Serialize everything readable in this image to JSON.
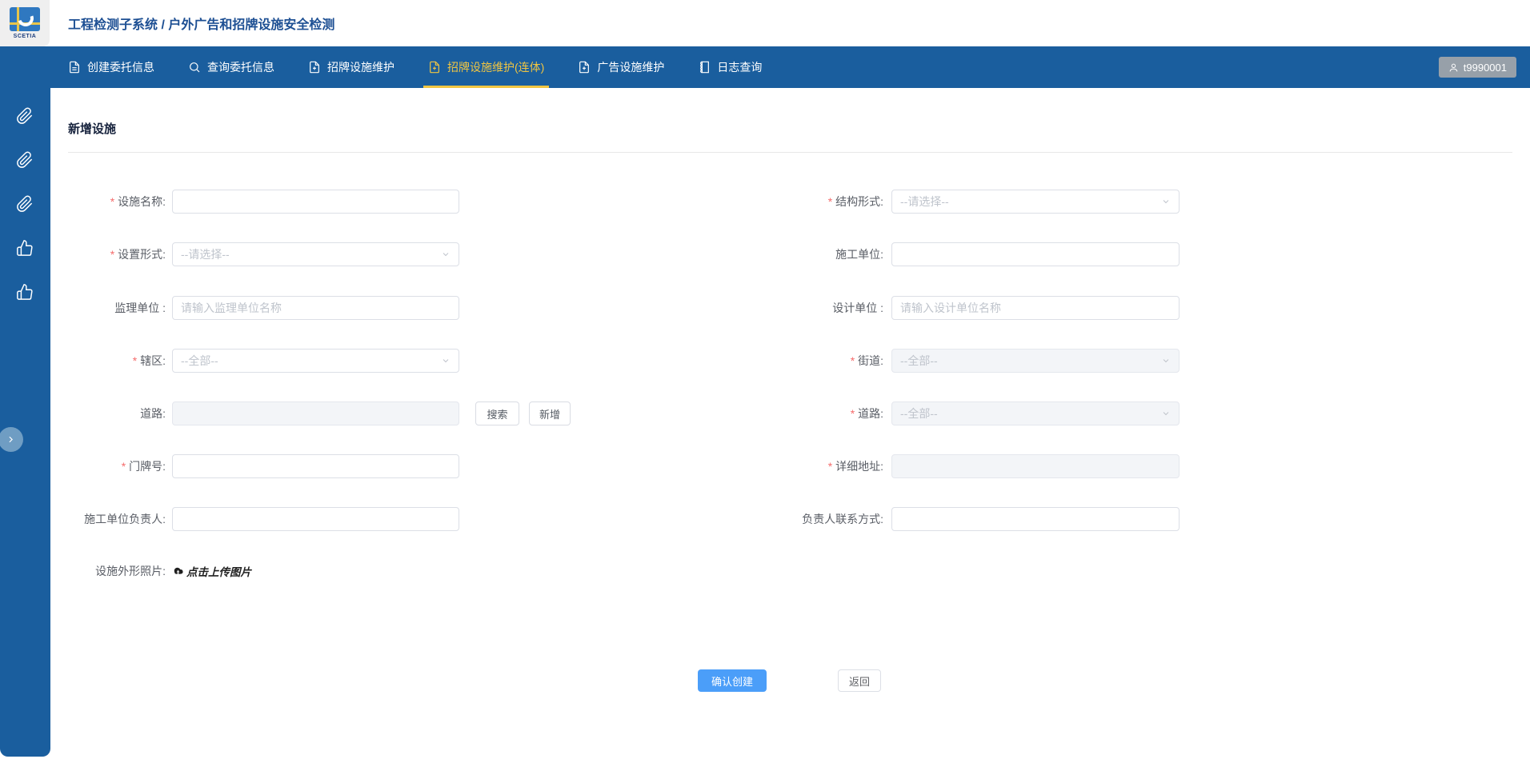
{
  "header": {
    "title": "工程检测子系统 / 户外广告和招牌设施安全检测",
    "logo_text": "SCETIA"
  },
  "navbar": {
    "tabs": [
      {
        "label": "创建委托信息",
        "icon": "document-icon",
        "active": false
      },
      {
        "label": "查询委托信息",
        "icon": "search-icon",
        "active": false
      },
      {
        "label": "招牌设施维护",
        "icon": "document-plus-icon",
        "active": false
      },
      {
        "label": "招牌设施维护(连体)",
        "icon": "document-plus-icon",
        "active": true
      },
      {
        "label": "广告设施维护",
        "icon": "document-plus-icon",
        "active": false
      },
      {
        "label": "日志查询",
        "icon": "log-book-icon",
        "active": false
      }
    ],
    "user": "t9990001"
  },
  "sidebar": {
    "icons": [
      "link-icon",
      "link-icon",
      "link-icon",
      "thumb-icon",
      "thumb-icon"
    ],
    "expand_icon": "chevron-right-icon"
  },
  "page": {
    "title": "新增设施"
  },
  "form": {
    "facility_name": {
      "label": "设施名称:",
      "required": true,
      "value": ""
    },
    "structure_type": {
      "label": "结构形式:",
      "required": true,
      "placeholder": "--请选择--"
    },
    "setup_type": {
      "label": "设置形式:",
      "required": true,
      "placeholder": "--请选择--"
    },
    "construction_unit": {
      "label": "施工单位:",
      "required": false,
      "value": ""
    },
    "supervision_unit": {
      "label": "监理单位 :",
      "required": false,
      "placeholder": "请输入监理单位名称"
    },
    "design_unit": {
      "label": "设计单位 :",
      "required": false,
      "placeholder": "请输入设计单位名称"
    },
    "district": {
      "label": "辖区:",
      "required": true,
      "placeholder": "--全部--"
    },
    "street": {
      "label": "街道:",
      "required": true,
      "placeholder": "--全部--",
      "disabled": true
    },
    "road_left": {
      "label": "道路:",
      "required": false,
      "value": "",
      "disabled": true,
      "search_button": "搜索",
      "add_button": "新增"
    },
    "road_right": {
      "label": "道路:",
      "required": true,
      "placeholder": "--全部--",
      "disabled": true
    },
    "house_number": {
      "label": "门牌号:",
      "required": true,
      "value": ""
    },
    "detail_address": {
      "label": "详细地址:",
      "required": true,
      "value": "",
      "disabled": true
    },
    "construction_manager": {
      "label": "施工单位负责人:",
      "required": false,
      "value": ""
    },
    "manager_contact": {
      "label": "负责人联系方式:",
      "required": false,
      "value": ""
    },
    "photo": {
      "label": "设施外形照片:",
      "upload_text": "点击上传图片"
    }
  },
  "actions": {
    "confirm": "确认创建",
    "back": "返回"
  },
  "colors": {
    "navbar_blue": "#1a5e9e",
    "active_tab_yellow": "#f0c542",
    "title_navy": "#1d4f93",
    "primary_button_blue": "#4b9ef9",
    "required_red": "#f56c6c",
    "input_border": "#dcdfe6",
    "disabled_bg": "#f3f5f8"
  }
}
